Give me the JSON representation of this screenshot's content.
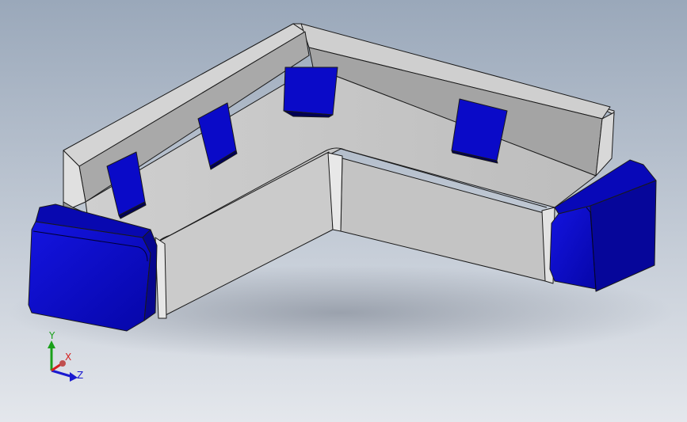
{
  "viewport": {
    "background_top": "#9aa8ba",
    "background_bottom": "#e4e7ec"
  },
  "model": {
    "body_color": "#c9c9c9",
    "body_dark": "#9e9e9e",
    "body_light": "#dcdcdc",
    "edge_color": "#1a1a1a",
    "cushion_color": "#0a0ac8",
    "cushion_dark": "#05057a"
  },
  "triad": {
    "x_label": "X",
    "y_label": "Y",
    "z_label": "Z",
    "x_color": "#d42020",
    "y_color": "#1aa01a",
    "z_color": "#1a1ad0"
  }
}
